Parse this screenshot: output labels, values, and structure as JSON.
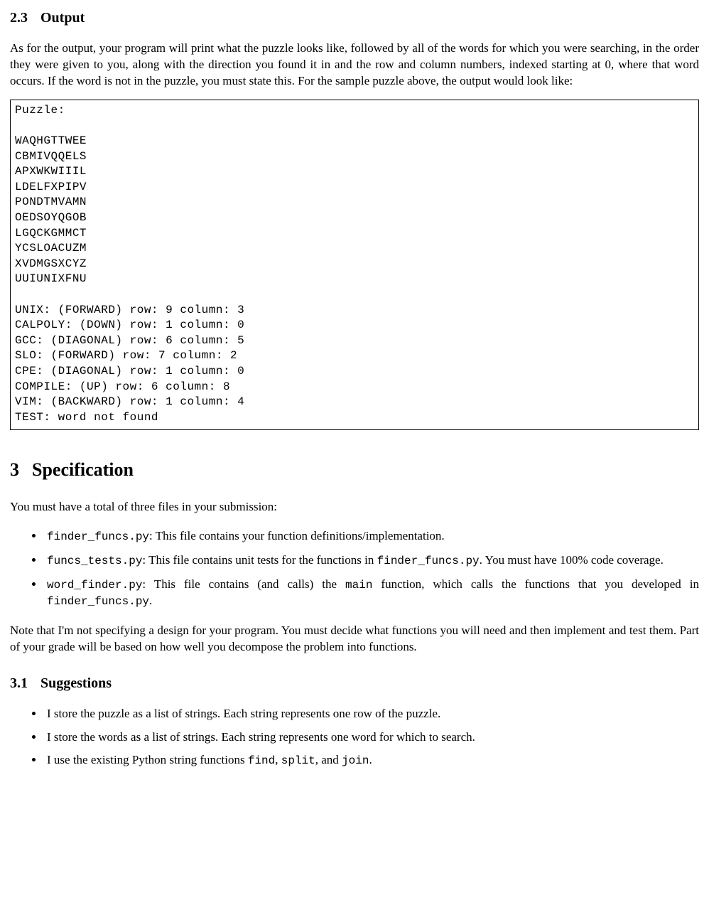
{
  "sec23": {
    "num": "2.3",
    "title": "Output"
  },
  "p1": "As for the output, your program will print what the puzzle looks like, followed by all of the words for which you were searching, in the order they were given to you, along with the direction you found it in and the row and column numbers, indexed starting at 0, where that word occurs. If the word is not in the puzzle, you must state this. For the sample puzzle above, the output would look like:",
  "code": "Puzzle:\n\nWAQHGTTWEE\nCBMIVQQELS\nAPXWKWIIIL\nLDELFXPIPV\nPONDTMVAMN\nOEDSOYQGOB\nLGQCKGMMCT\nYCSLOACUZM\nXVDMGSXCYZ\nUUIUNIXFNU\n\nUNIX: (FORWARD) row: 9 column: 3\nCALPOLY: (DOWN) row: 1 column: 0\nGCC: (DIAGONAL) row: 6 column: 5\nSLO: (FORWARD) row: 7 column: 2\nCPE: (DIAGONAL) row: 1 column: 0\nCOMPILE: (UP) row: 6 column: 8\nVIM: (BACKWARD) row: 1 column: 4\nTEST: word not found",
  "sec3": {
    "num": "3",
    "title": "Specification"
  },
  "p2": "You must have a total of three files in your submission:",
  "files": {
    "a_code": "finder_funcs.py",
    "a_text": ": This file contains your function definitions/implementation.",
    "b_code": "funcs_tests.py",
    "b_text1": ": This file contains unit tests for the functions in ",
    "b_code2": "finder_funcs.py",
    "b_text2": ". You must have 100% code coverage.",
    "c_code": "word_finder.py",
    "c_text1": ": This file contains (and calls) the ",
    "c_code2": "main",
    "c_text2": " function, which calls the functions that you developed in ",
    "c_code3": "finder_funcs.py",
    "c_text3": "."
  },
  "p3": "Note that I'm not specifying a design for your program. You must decide what functions you will need and then implement and test them. Part of your grade will be based on how well you decompose the problem into functions.",
  "sec31": {
    "num": "3.1",
    "title": "Suggestions"
  },
  "sugg": {
    "a": "I store the puzzle as a list of strings. Each string represents one row of the puzzle.",
    "b": "I store the words as a list of strings. Each string represents one word for which to search.",
    "c1": "I use the existing Python string functions ",
    "c_code1": "find",
    "c2": ", ",
    "c_code2": "split",
    "c3": ", and ",
    "c_code3": "join",
    "c4": "."
  }
}
